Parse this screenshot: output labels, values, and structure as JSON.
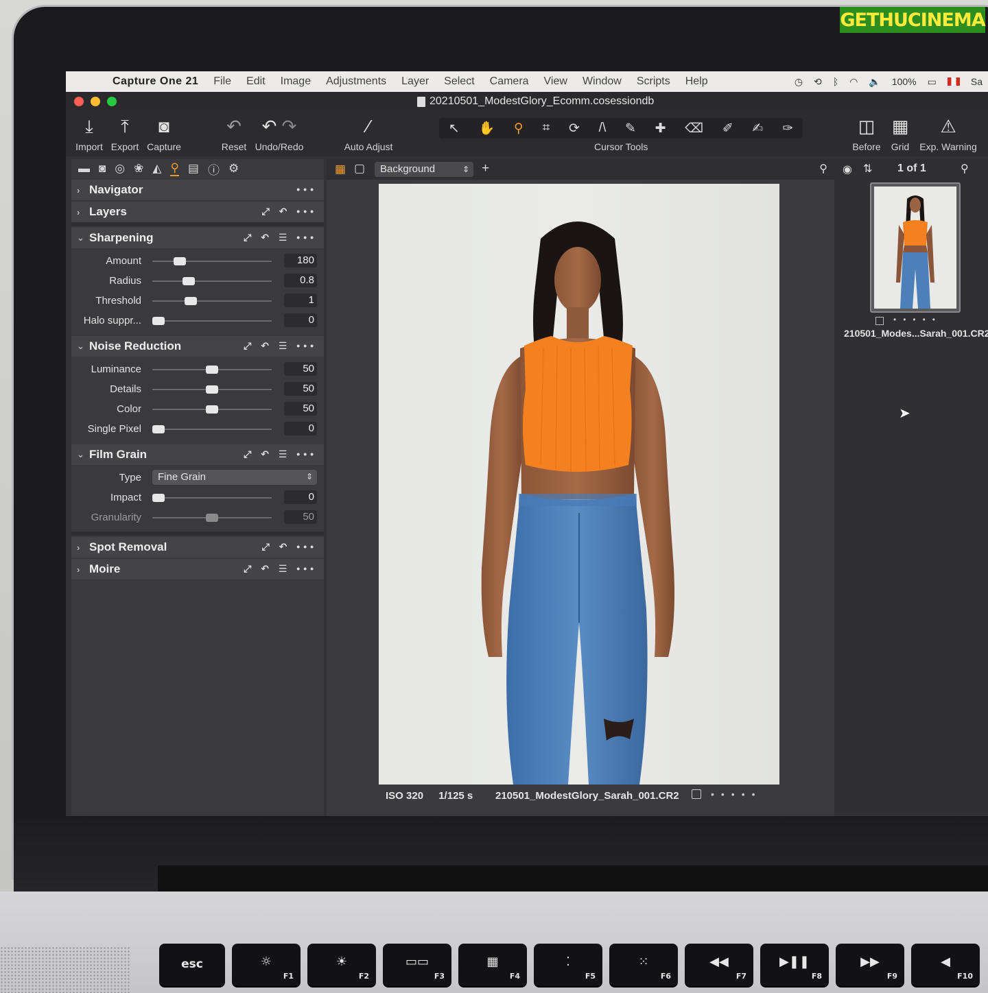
{
  "watermark": "GETHUCINEMA",
  "menubar": {
    "app_name": "Capture One 21",
    "menus": [
      "File",
      "Edit",
      "Image",
      "Adjustments",
      "Layer",
      "Select",
      "Camera",
      "View",
      "Window",
      "Scripts",
      "Help"
    ],
    "battery": "100%",
    "user_truncated": "Sa"
  },
  "window": {
    "title": "20210501_ModestGlory_Ecomm.cosessiondb"
  },
  "toolbar": {
    "import": "Import",
    "export": "Export",
    "capture": "Capture",
    "reset": "Reset",
    "undo_redo": "Undo/Redo",
    "auto_adjust": "Auto Adjust",
    "cursor_tools": "Cursor Tools",
    "before": "Before",
    "grid": "Grid",
    "exp_warning": "Exp. Warning"
  },
  "tools": {
    "navigator": "Navigator",
    "layers": "Layers",
    "sharpening": {
      "title": "Sharpening",
      "rows": [
        {
          "label": "Amount",
          "value": "180",
          "fraction": 0.2
        },
        {
          "label": "Radius",
          "value": "0.8",
          "fraction": 0.28
        },
        {
          "label": "Threshold",
          "value": "1",
          "fraction": 0.3
        },
        {
          "label": "Halo suppr...",
          "value": "0",
          "fraction": 0.0
        }
      ]
    },
    "noise_reduction": {
      "title": "Noise Reduction",
      "rows": [
        {
          "label": "Luminance",
          "value": "50",
          "fraction": 0.5
        },
        {
          "label": "Details",
          "value": "50",
          "fraction": 0.5
        },
        {
          "label": "Color",
          "value": "50",
          "fraction": 0.5
        },
        {
          "label": "Single Pixel",
          "value": "0",
          "fraction": 0.0
        }
      ]
    },
    "film_grain": {
      "title": "Film Grain",
      "type_label": "Type",
      "type_value": "Fine Grain",
      "impact_label": "Impact",
      "impact_value": "0",
      "impact_fraction": 0.0,
      "granularity_label": "Granularity",
      "granularity_value": "50",
      "granularity_fraction": 0.5
    },
    "spot_removal": "Spot Removal",
    "moire": "Moire"
  },
  "viewer": {
    "layer_select": "Background",
    "iso": "ISO 320",
    "shutter": "1/125 s",
    "filename": "210501_ModestGlory_Sarah_001.CR2"
  },
  "browser": {
    "count": "1 of 1",
    "thumb_name": "210501_Modes...Sarah_001.CR2"
  },
  "keyboard": {
    "keys": [
      {
        "glyph": "esc",
        "fn": ""
      },
      {
        "glyph": "☼",
        "fn": "F1"
      },
      {
        "glyph": "☀",
        "fn": "F2"
      },
      {
        "glyph": "▭▭",
        "fn": "F3"
      },
      {
        "glyph": "▦",
        "fn": "F4"
      },
      {
        "glyph": "⁚",
        "fn": "F5"
      },
      {
        "glyph": "⁙",
        "fn": "F6"
      },
      {
        "glyph": "◀◀",
        "fn": "F7"
      },
      {
        "glyph": "▶❚❚",
        "fn": "F8"
      },
      {
        "glyph": "▶▶",
        "fn": "F9"
      },
      {
        "glyph": "◀",
        "fn": "F10"
      }
    ]
  },
  "colors": {
    "accent": "#f39c2a",
    "panel": "#3a3a3c",
    "top_orange": "#f5801f",
    "jeans": "#4d7fb8"
  }
}
